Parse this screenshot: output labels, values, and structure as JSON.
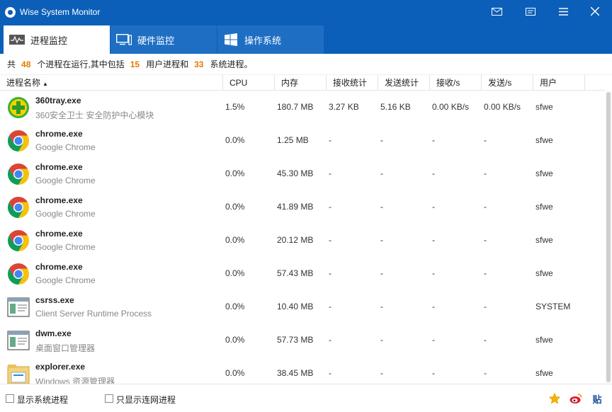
{
  "window": {
    "title": "Wise System Monitor"
  },
  "titlebar_icons": [
    "mail-icon",
    "feedback-icon",
    "menu-icon",
    "close-icon"
  ],
  "tabs": [
    {
      "label": "进程监控",
      "icon": "process-monitor-icon",
      "active": true
    },
    {
      "label": "硬件监控",
      "icon": "hardware-monitor-icon",
      "active": false
    },
    {
      "label": "操作系统",
      "icon": "windows-logo-icon",
      "active": false
    }
  ],
  "summary": {
    "prefix": "共",
    "total": "48",
    "mid1": "个进程在运行,其中包括",
    "user": "15",
    "mid2": "用户进程和",
    "system": "33",
    "suffix": "系统进程。"
  },
  "columns": [
    "进程名称",
    "CPU",
    "内存",
    "接收统计",
    "发送统计",
    "接收/s",
    "发送/s",
    "用户"
  ],
  "sort_indicator": "▲",
  "processes": [
    {
      "name": "360tray.exe",
      "desc": "360安全卫士 安全防护中心模块",
      "icon": "360-icon",
      "cpu": "1.5%",
      "mem": "180.7 MB",
      "recv": "3.27 KB",
      "sent": "5.16 KB",
      "recv_s": "0.00 KB/s",
      "sent_s": "0.00 KB/s",
      "user": "sfwe"
    },
    {
      "name": "chrome.exe",
      "desc": "Google Chrome",
      "icon": "chrome-icon",
      "cpu": "0.0%",
      "mem": "1.25 MB",
      "recv": "-",
      "sent": "-",
      "recv_s": "-",
      "sent_s": "-",
      "user": "sfwe"
    },
    {
      "name": "chrome.exe",
      "desc": "Google Chrome",
      "icon": "chrome-icon",
      "cpu": "0.0%",
      "mem": "45.30 MB",
      "recv": "-",
      "sent": "-",
      "recv_s": "-",
      "sent_s": "-",
      "user": "sfwe"
    },
    {
      "name": "chrome.exe",
      "desc": "Google Chrome",
      "icon": "chrome-icon",
      "cpu": "0.0%",
      "mem": "41.89 MB",
      "recv": "-",
      "sent": "-",
      "recv_s": "-",
      "sent_s": "-",
      "user": "sfwe"
    },
    {
      "name": "chrome.exe",
      "desc": "Google Chrome",
      "icon": "chrome-icon",
      "cpu": "0.0%",
      "mem": "20.12 MB",
      "recv": "-",
      "sent": "-",
      "recv_s": "-",
      "sent_s": "-",
      "user": "sfwe"
    },
    {
      "name": "chrome.exe",
      "desc": "Google Chrome",
      "icon": "chrome-icon",
      "cpu": "0.0%",
      "mem": "57.43 MB",
      "recv": "-",
      "sent": "-",
      "recv_s": "-",
      "sent_s": "-",
      "user": "sfwe"
    },
    {
      "name": "csrss.exe",
      "desc": "Client Server Runtime Process",
      "icon": "system-process-icon",
      "cpu": "0.0%",
      "mem": "10.40 MB",
      "recv": "-",
      "sent": "-",
      "recv_s": "-",
      "sent_s": "-",
      "user": "SYSTEM"
    },
    {
      "name": "dwm.exe",
      "desc": "桌面窗口管理器",
      "icon": "system-process-icon",
      "cpu": "0.0%",
      "mem": "57.73 MB",
      "recv": "-",
      "sent": "-",
      "recv_s": "-",
      "sent_s": "-",
      "user": "sfwe"
    },
    {
      "name": "explorer.exe",
      "desc": "Windows 资源管理器",
      "icon": "explorer-icon",
      "cpu": "0.0%",
      "mem": "38.45 MB",
      "recv": "-",
      "sent": "-",
      "recv_s": "-",
      "sent_s": "-",
      "user": "sfwe"
    }
  ],
  "footer": {
    "show_system": "显示系统进程",
    "only_network": "只显示连网进程",
    "icons": [
      "star-icon",
      "weibo-icon",
      "tieba-icon"
    ],
    "tieba_glyph": "贴"
  },
  "colors": {
    "titlebar": "#0b5fb8",
    "tab_inactive": "#1e6fc4",
    "accent_number": "#e07b00"
  }
}
